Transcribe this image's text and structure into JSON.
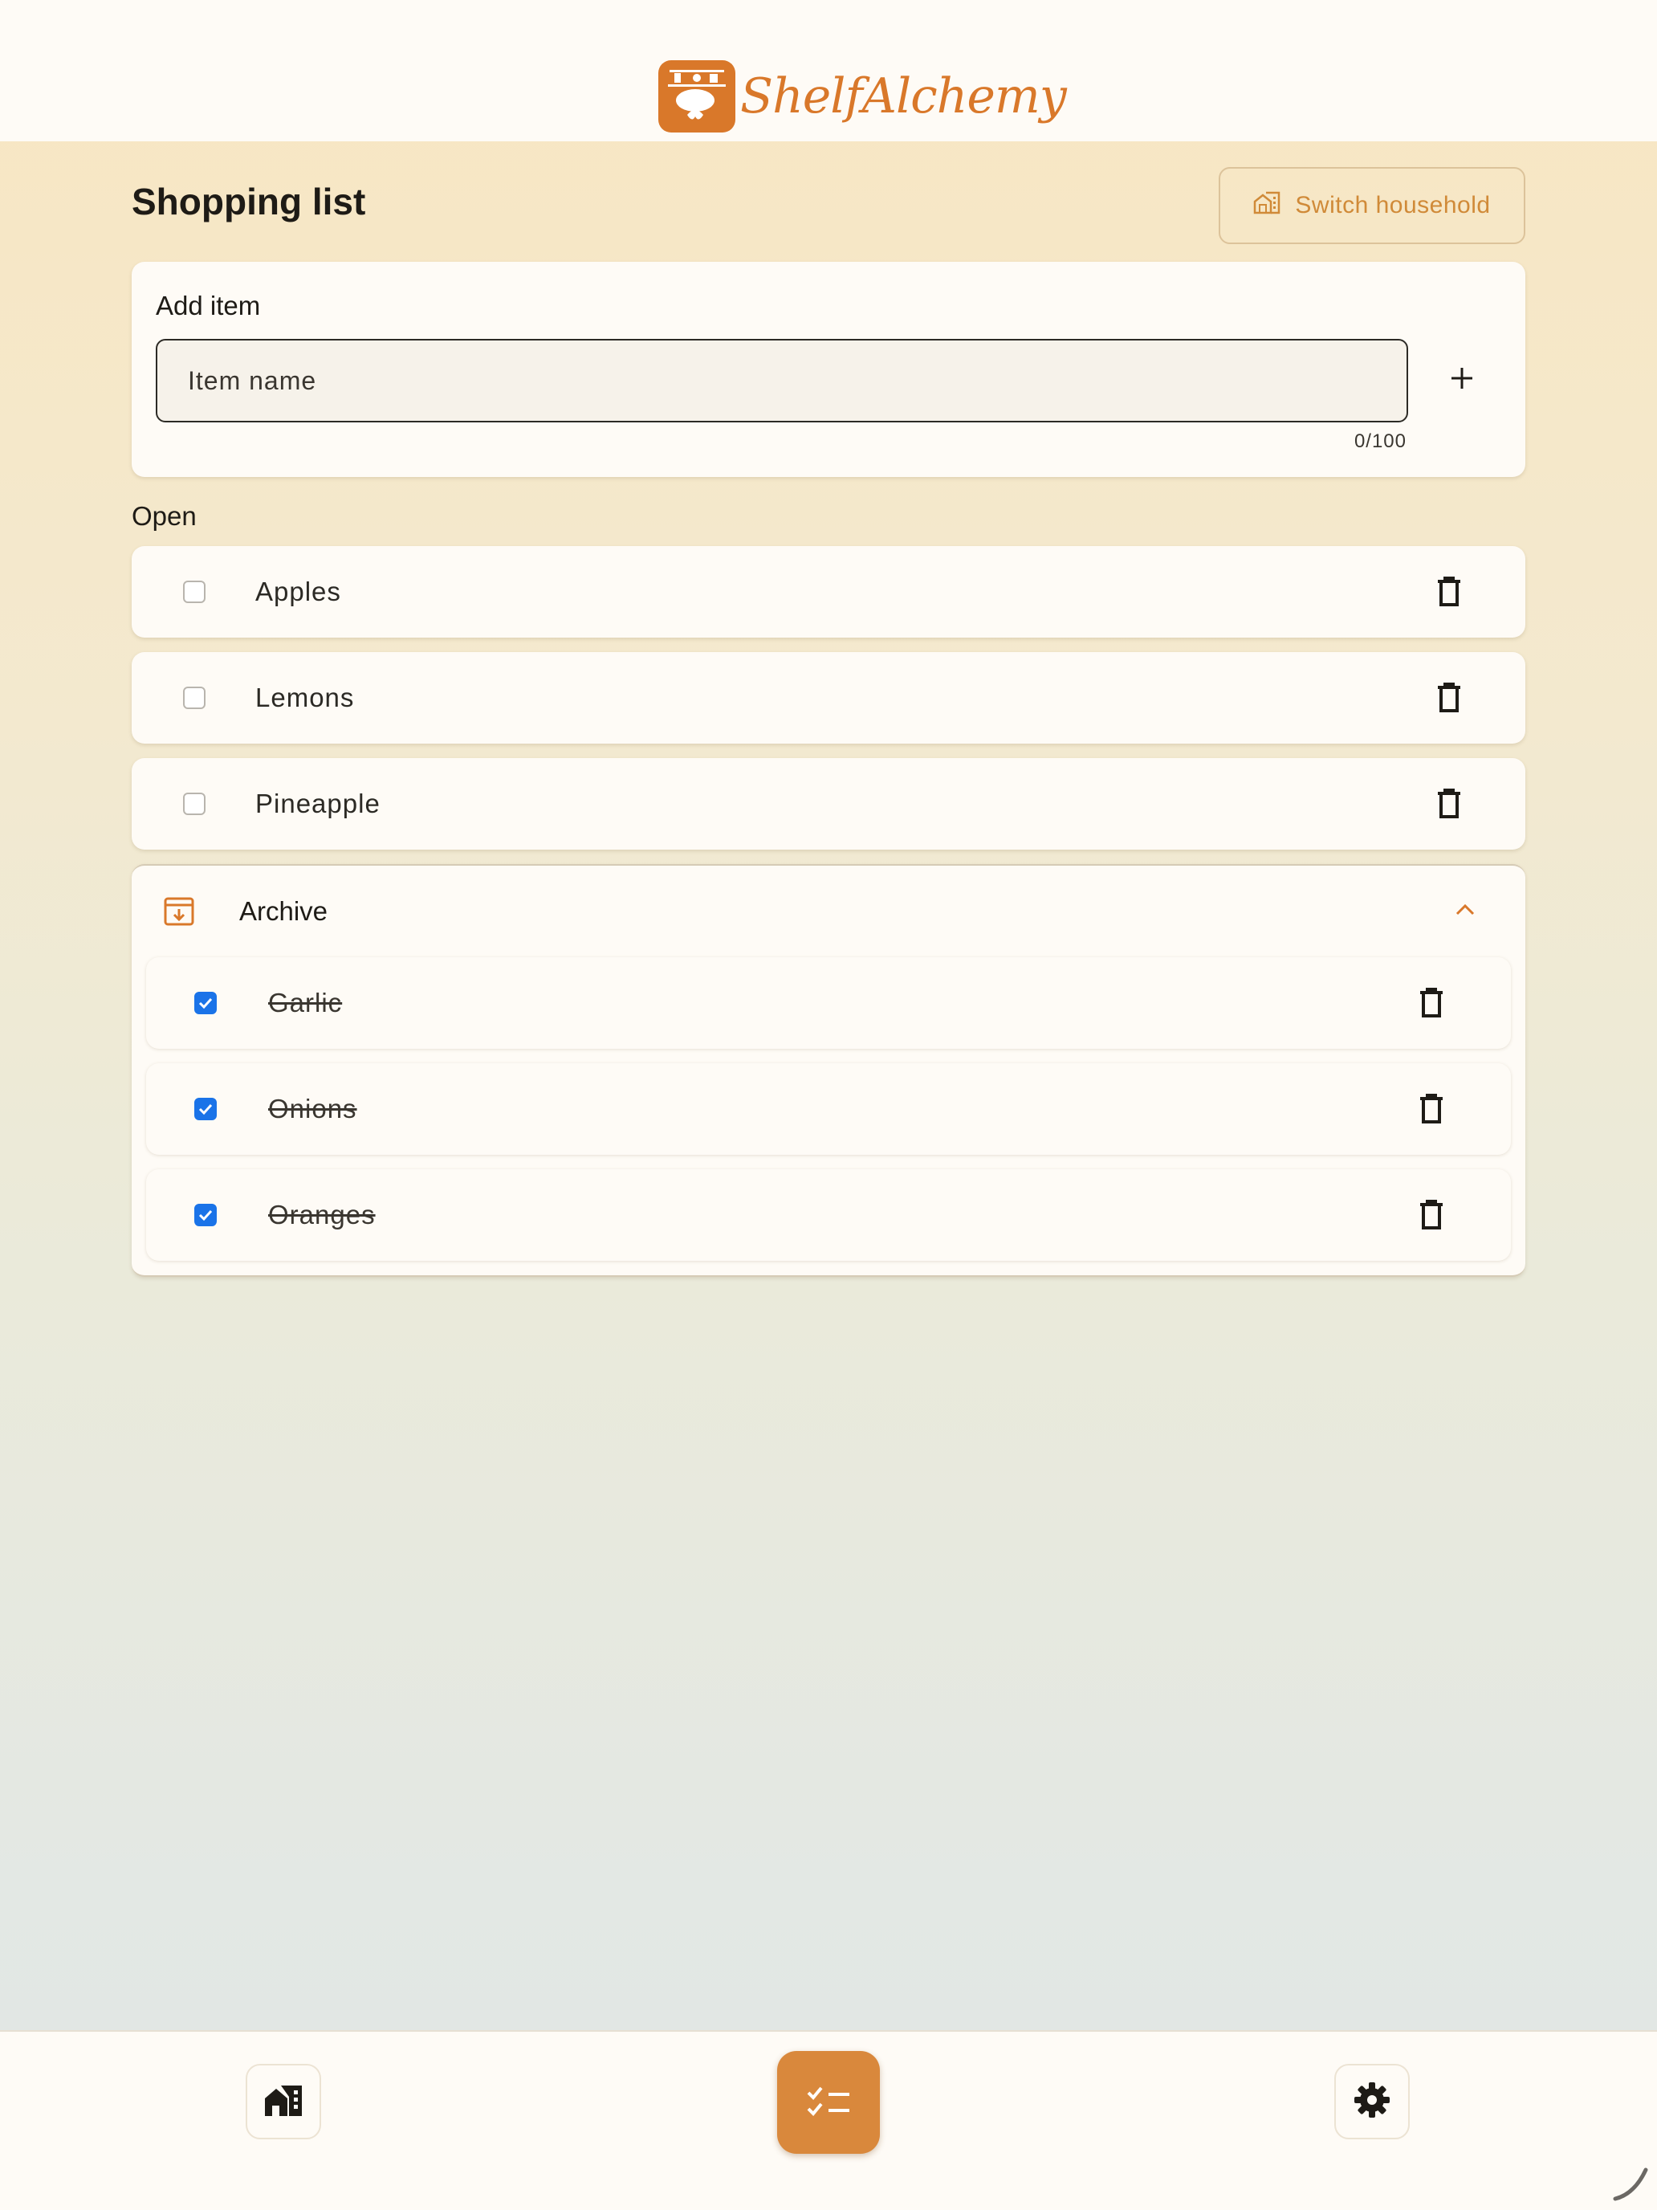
{
  "status_bar": {
    "time": "",
    "right": ""
  },
  "app": {
    "name": "ShelfAlchemy"
  },
  "page": {
    "title": "Shopping list"
  },
  "header": {
    "switch_household_label": "Switch household"
  },
  "add_item": {
    "label": "Add item",
    "placeholder": "Item name",
    "value": "",
    "counter": "0/100"
  },
  "open_section": {
    "label": "Open",
    "items": [
      {
        "name": "Apples",
        "checked": false
      },
      {
        "name": "Lemons",
        "checked": false
      },
      {
        "name": "Pineapple",
        "checked": false
      }
    ]
  },
  "archive_section": {
    "label": "Archive",
    "expanded": true,
    "items": [
      {
        "name": "Garlic",
        "checked": true
      },
      {
        "name": "Onions",
        "checked": true
      },
      {
        "name": "Oranges",
        "checked": true
      }
    ]
  },
  "bottom_nav": {
    "items": [
      {
        "icon": "household-icon",
        "active": false
      },
      {
        "icon": "checklist-icon",
        "active": true
      },
      {
        "icon": "gear-icon",
        "active": false
      }
    ]
  },
  "colors": {
    "accent": "#d9883c",
    "brand": "#d9782a",
    "checkbox_checked": "#1a73e8",
    "surface": "#fefbf6"
  }
}
